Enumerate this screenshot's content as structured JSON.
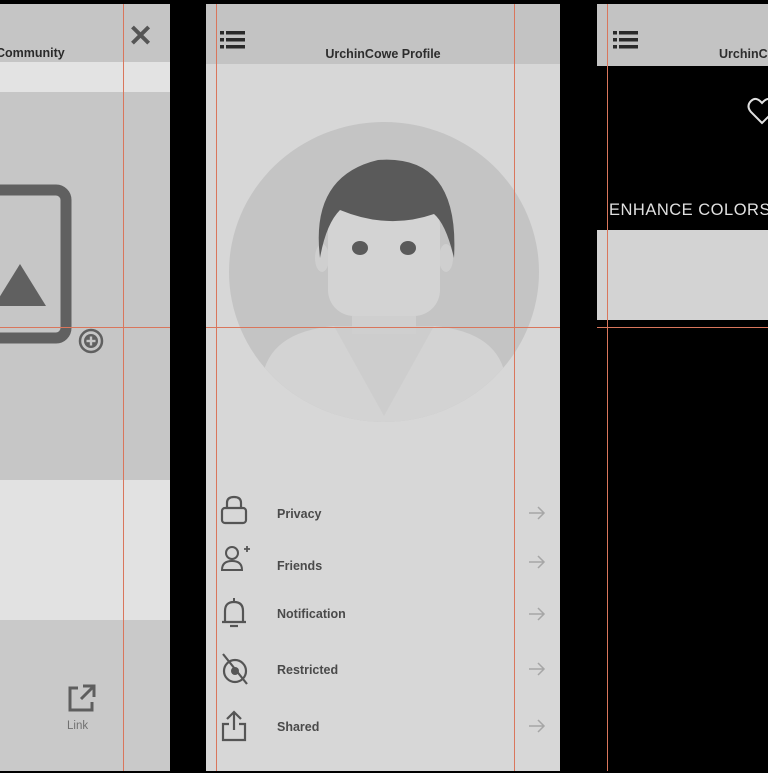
{
  "screens": {
    "community": {
      "title": "Community",
      "close_icon": "close-icon",
      "link_label": "Link"
    },
    "profile": {
      "title": "UrchinCowe Profile",
      "menu_items": [
        {
          "label": "Privacy",
          "icon": "lock-icon"
        },
        {
          "label": "Friends",
          "icon": "add-friend-icon"
        },
        {
          "label": "Notification",
          "icon": "bell-icon"
        },
        {
          "label": "Restricted",
          "icon": "restricted-icon"
        },
        {
          "label": "Shared",
          "icon": "share-icon"
        }
      ]
    },
    "enhance": {
      "title": "UrchinC",
      "enhance_label": "ENHANCE COLORS"
    }
  },
  "colors": {
    "guide": "#d9765c",
    "header": "#c3c3c3",
    "panel": "#d7d7d7",
    "icon": "#5e5e5e"
  }
}
